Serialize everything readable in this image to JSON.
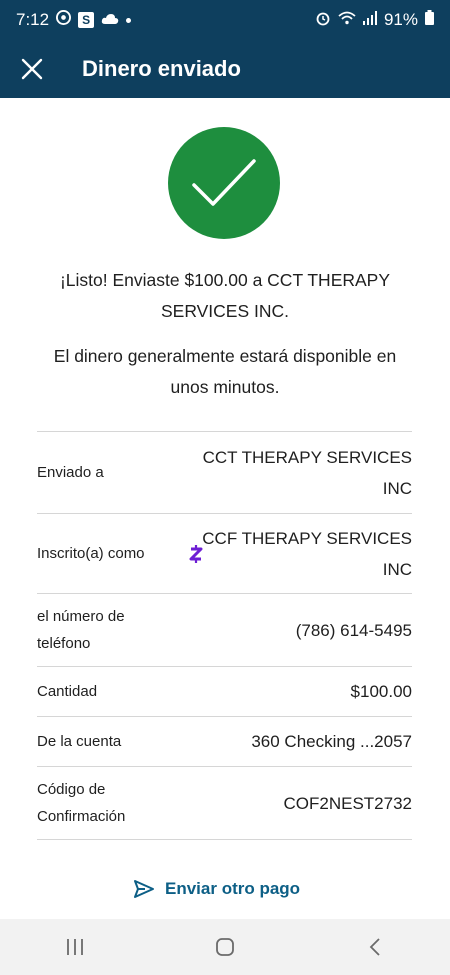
{
  "status_bar": {
    "time": "7:12",
    "battery": "91%"
  },
  "app_bar": {
    "title": "Dinero enviado",
    "close_icon": "close-icon"
  },
  "confirmation": {
    "icon": "check-icon",
    "color": "#1e8e3e",
    "message_line1": "¡Listo! Enviaste $100.00 a CCT THERAPY SERVICES INC.",
    "message_line2": "El dinero generalmente estará disponible en unos minutos."
  },
  "details": [
    {
      "label": "Enviado a",
      "value": "CCT THERAPY SERVICES INC"
    },
    {
      "label": "Inscrito(a) como",
      "value": "CCF THERAPY SERVICES INC",
      "icon": "zelle-icon"
    },
    {
      "label": "el número de teléfono",
      "value": "(786) 614-5495"
    },
    {
      "label": "Cantidad",
      "value": "$100.00"
    },
    {
      "label": "De la cuenta",
      "value": "360 Checking ...2057"
    },
    {
      "label": "Código de Confirmación",
      "value": "COF2NEST2732"
    }
  ],
  "actions": {
    "send_again_label": "Enviar otro pago",
    "send_again_icon": "send-icon",
    "accent_color": "#0d5f86"
  },
  "colors": {
    "header_bg": "#0e3f5e"
  }
}
